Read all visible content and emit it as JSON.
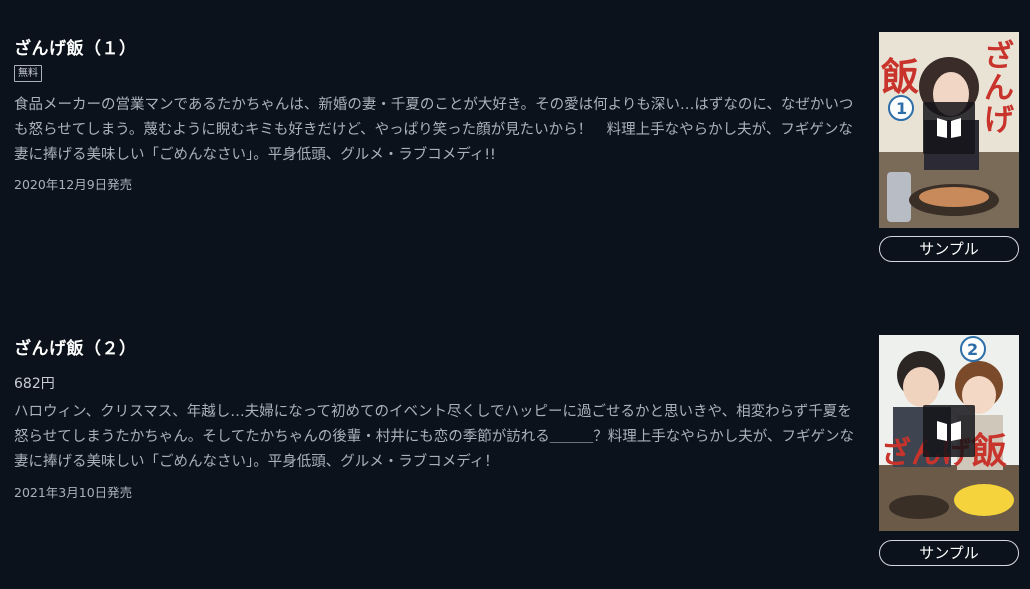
{
  "items": [
    {
      "title": "ざんげ飯（１）",
      "badge": "無料",
      "description": "食品メーカーの営業マンであるたかちゃんは、新婚の妻・千夏のことが大好き。その愛は何よりも深い…はずなのに、なぜかいつも怒らせてしまう。蔑むように睨むキミも好きだけど、やっぱり笑った顔が見たいから！　料理上手なやらかし夫が、フギゲンな妻に捧げる美味しい「ごめんなさい」。平身低頭、グルメ・ラブコメディ!!",
      "date": "2020年12月9日発売",
      "sample_label": "サンプル",
      "cover_number": "1",
      "cover_title": "飯 ざんげ"
    },
    {
      "title": "ざんげ飯（２）",
      "price": "682円",
      "description": "ハロウィン、クリスマス、年越し…夫婦になって初めてのイベント尽くしでハッピーに過ごせるかと思いきや、相変わらず千夏を怒らせてしまうたかちゃん。そしてたかちゃんの後輩・村井にも恋の季節が訪れる＿＿＿？料理上手なやらかし夫が、フギゲンな妻に捧げる美味しい「ごめんなさい」。平身低頭、グルメ・ラブコメディ！",
      "date": "2021年3月10日発売",
      "sample_label": "サンプル",
      "cover_number": "2",
      "cover_title": "ざんげ 飯"
    }
  ],
  "colors": {
    "background": "#0b121b",
    "title": "#ffffff",
    "text": "#aab1bb",
    "cover_title_red": "#c8332b",
    "cover_number_blue": "#2d6ea8"
  },
  "icons": [
    "book-preview-icon"
  ]
}
